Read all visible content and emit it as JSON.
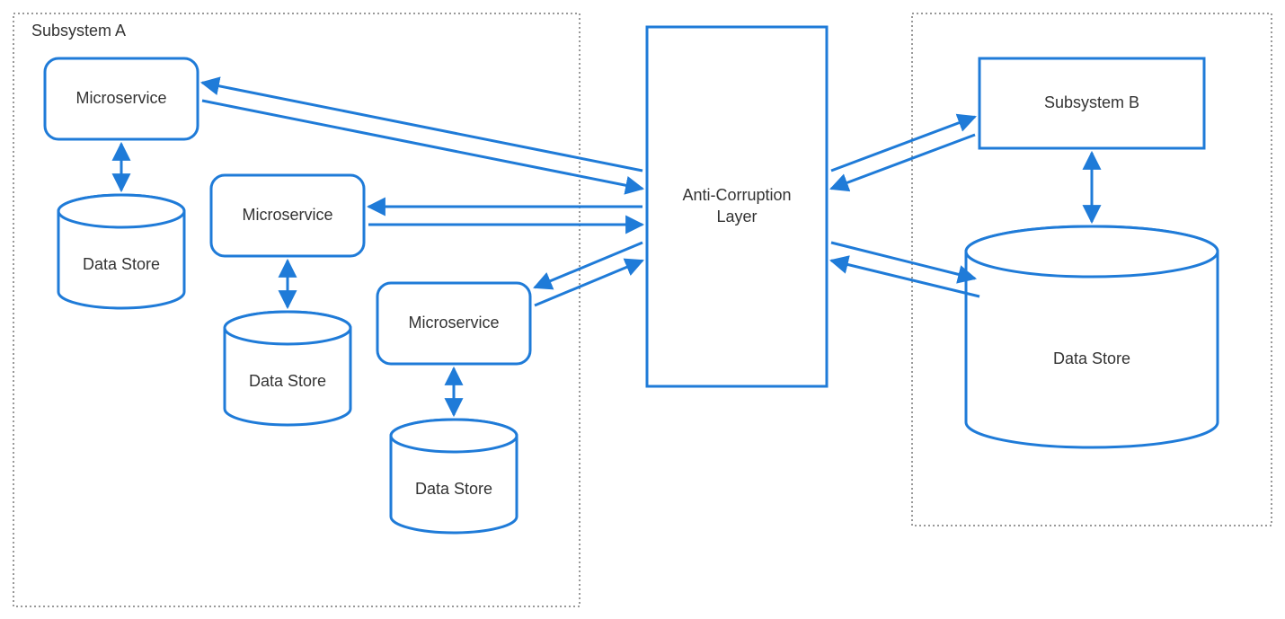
{
  "colors": {
    "blue": "#1f7bd8",
    "blueFill": "#ffffff"
  },
  "subsystemA": {
    "label": "Subsystem A",
    "services": [
      {
        "ms_label": "Microservice",
        "ds_label": "Data Store"
      },
      {
        "ms_label": "Microservice",
        "ds_label": "Data Store"
      },
      {
        "ms_label": "Microservice",
        "ds_label": "Data Store"
      }
    ]
  },
  "acl": {
    "label_line1": "Anti-Corruption",
    "label_line2": "Layer"
  },
  "subsystemB": {
    "label": "Subsystem B",
    "ds_label": "Data Store"
  }
}
